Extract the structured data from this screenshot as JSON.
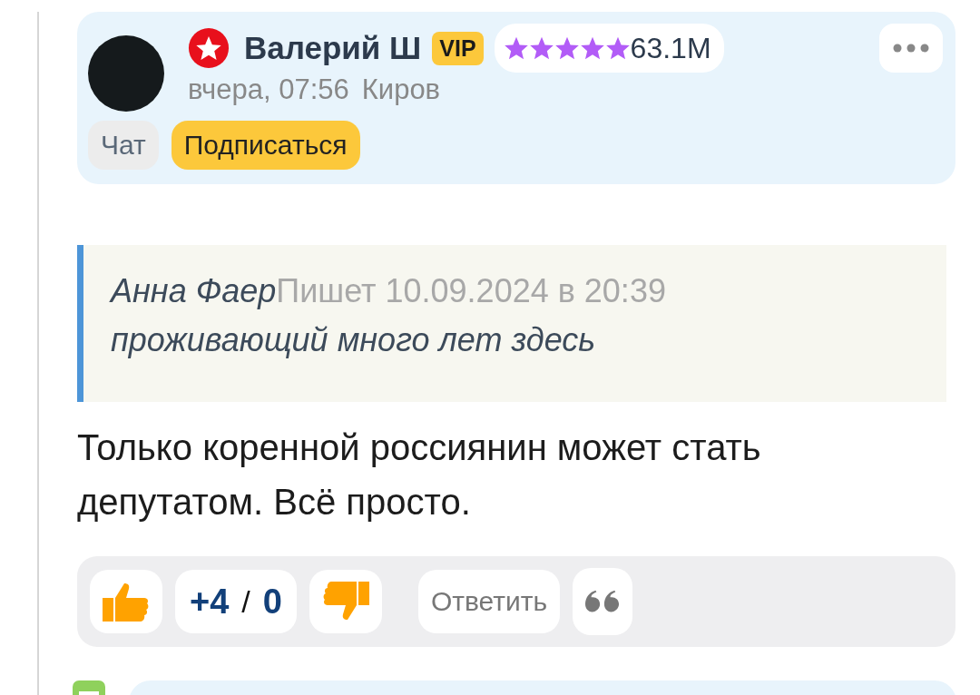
{
  "comment": {
    "author": {
      "name": "Валерий Ш",
      "badge": "VIP",
      "stars": 5,
      "rating": "63.1M",
      "time": "вчера, 07:56",
      "city": "Киров"
    },
    "buttons": [
      {
        "label": "Чат",
        "kind": "plain"
      },
      {
        "label": "Подписаться",
        "kind": "accent"
      }
    ],
    "quote": {
      "author": "Анна Фаер",
      "meta": "Пишет 10.09.2024 в 20:39",
      "text": "проживающий много лет здесь"
    },
    "text": "Только коренной россиянин может стать депутатом. Всё просто.",
    "votes": {
      "plus": "+4",
      "separator": "/",
      "minus": "0"
    },
    "reply": "Ответить"
  },
  "next_comment": {
    "collapsed": false
  }
}
